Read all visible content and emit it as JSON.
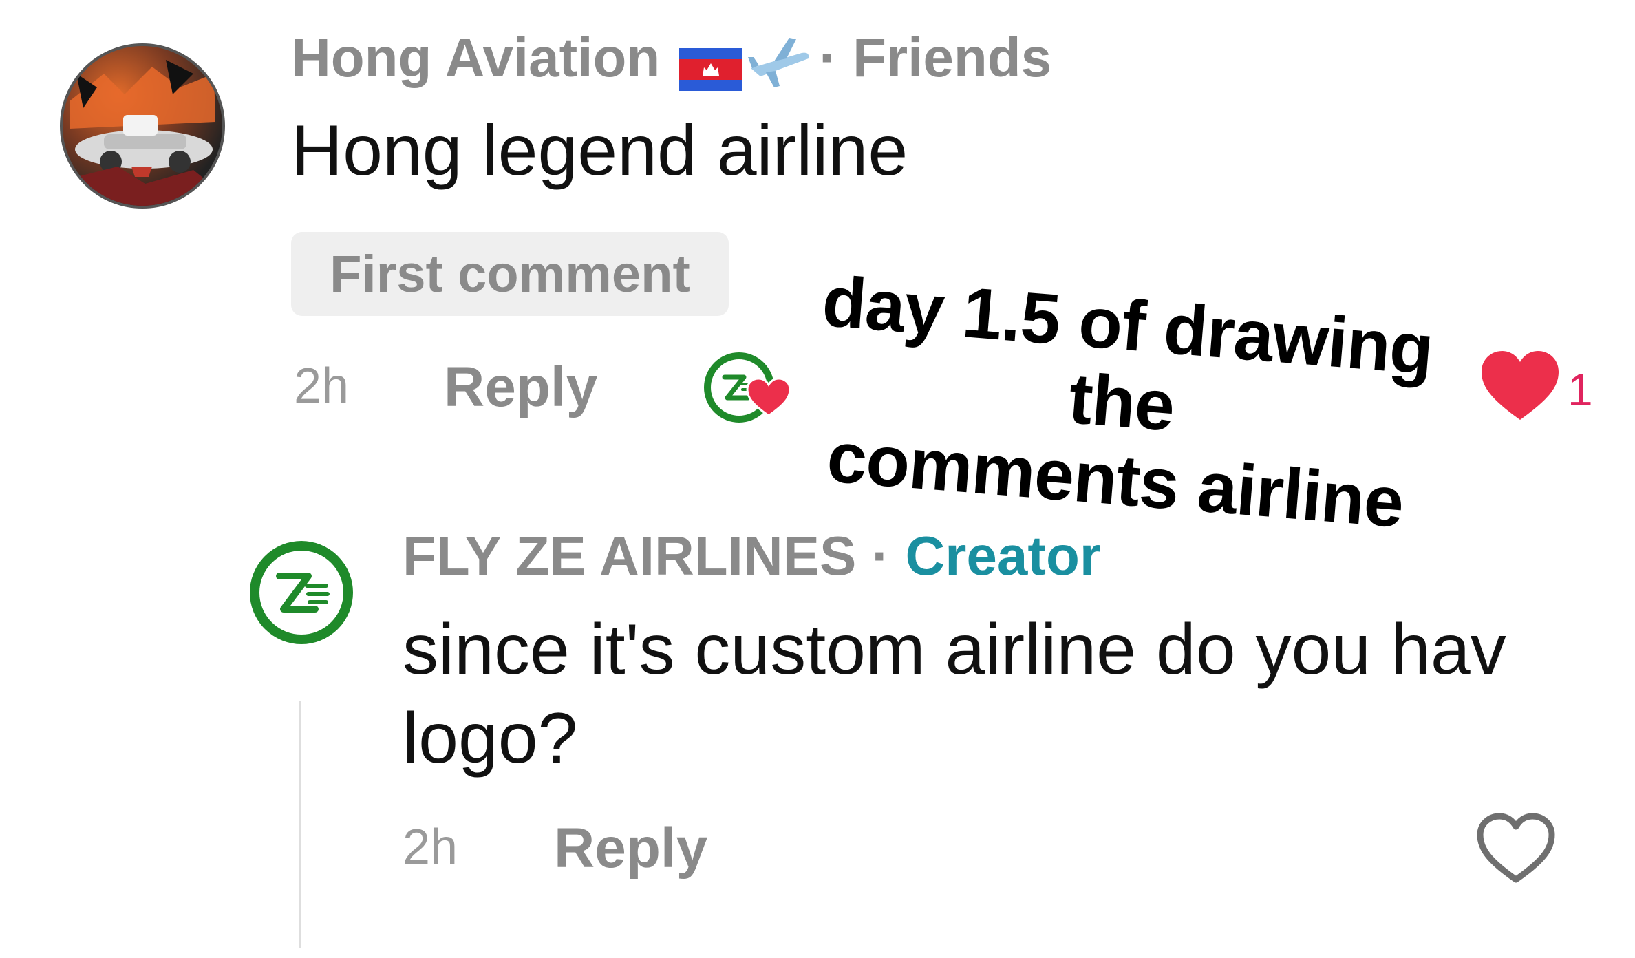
{
  "comment1": {
    "author": "Hong Aviation",
    "separator": "·",
    "relation": "Friends",
    "body": "Hong legend airline",
    "badge": "First comment",
    "time": "2h",
    "reply_label": "Reply",
    "like_count": "1",
    "icons": {
      "flag": "cambodia-flag-icon",
      "plane": "airplane-icon",
      "liked": "heart-filled-icon"
    }
  },
  "overlay_caption": {
    "line1": "day 1.5 of drawing the",
    "line2": "comments airline"
  },
  "comment2": {
    "author": "FLY ZE AIRLINES",
    "separator": "·",
    "role": "Creator",
    "body_line1": "since it's custom airline do you hav",
    "body_line2": "logo?",
    "time": "2h",
    "reply_label": "Reply",
    "icons": {
      "like": "heart-outline-icon"
    }
  },
  "colors": {
    "creator_label": "#1a8fa0",
    "like_red": "#e0245e",
    "logo_green": "#1f8a2a",
    "muted_text": "#8a8a8a"
  }
}
